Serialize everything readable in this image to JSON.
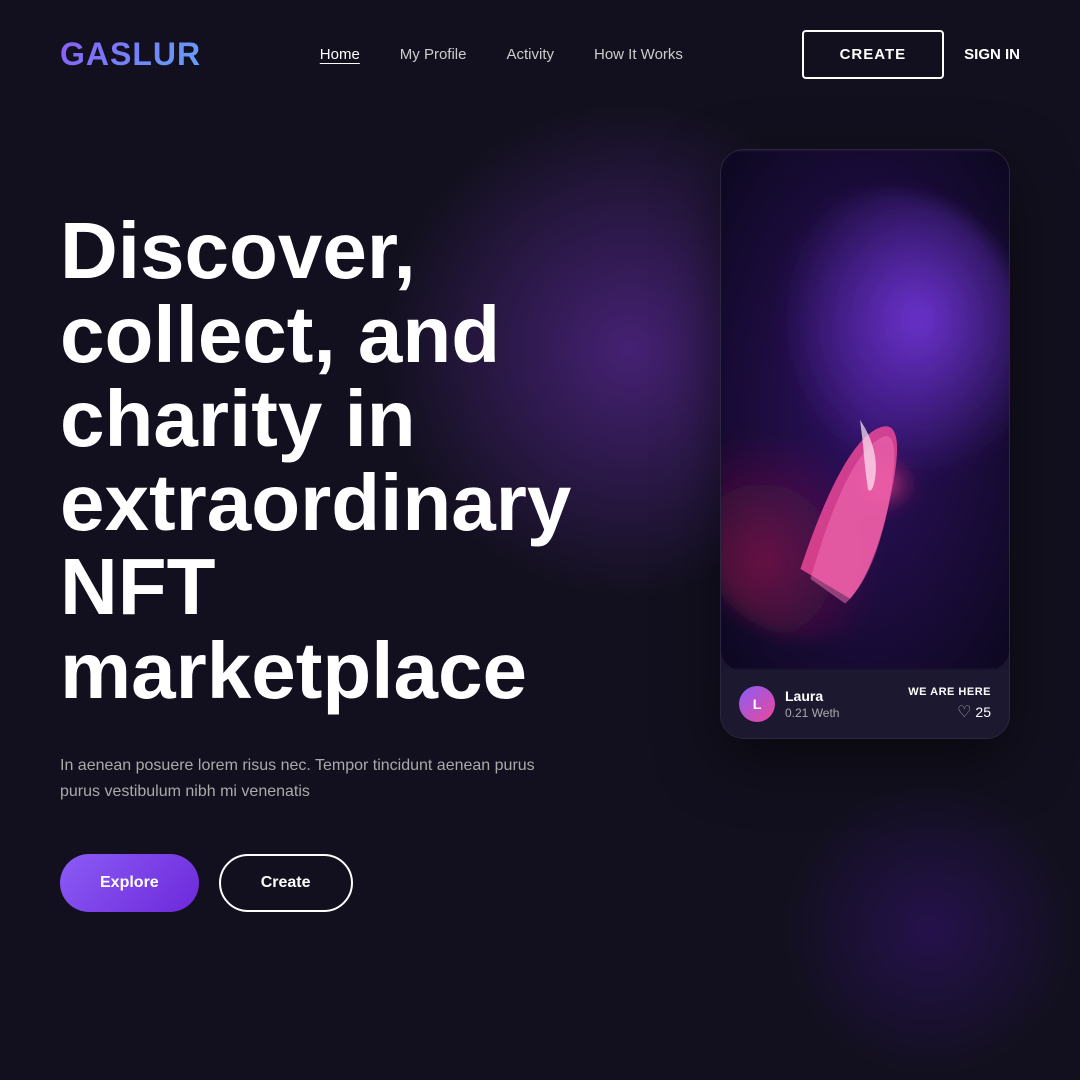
{
  "brand": {
    "logo": "GASLUR"
  },
  "nav": {
    "links": [
      {
        "label": "Home",
        "active": true
      },
      {
        "label": "My Profile",
        "active": false
      },
      {
        "label": "Activity",
        "active": false
      },
      {
        "label": "How It Works",
        "active": false
      }
    ],
    "create_button": "CREATE",
    "signin_button": "SIGN IN"
  },
  "hero": {
    "title": "Discover, collect, and charity in extraordinary NFT marketplace",
    "description": "In aenean posuere lorem risus nec. Tempor tincidunt aenean purus purus vestibulum nibh mi venenatis",
    "explore_button": "Explore",
    "create_button": "Create"
  },
  "nft_card": {
    "title": "WE ARE HERE",
    "user_name": "Laura",
    "price": "0.21 Weth",
    "likes": "25",
    "avatar_initials": "L"
  }
}
